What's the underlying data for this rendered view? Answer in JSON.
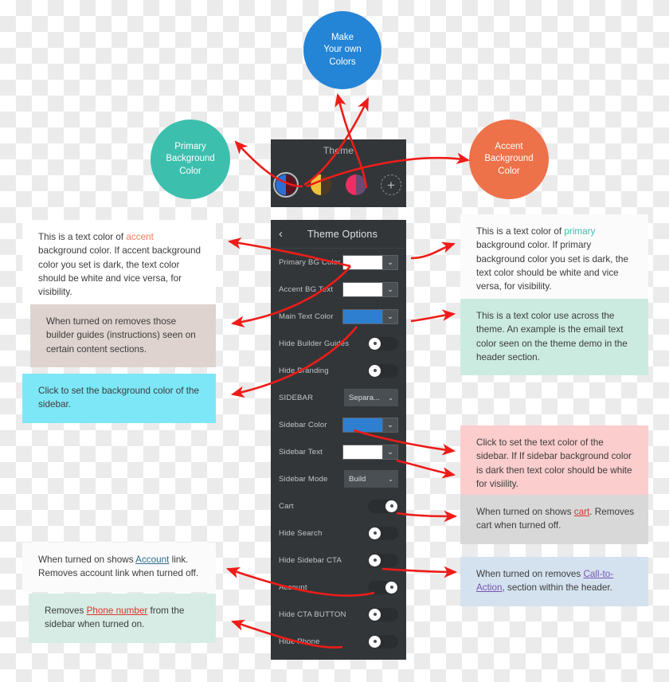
{
  "bubbles": [
    {
      "id": "make-your-own-colors",
      "lines": [
        "Make",
        "Your own",
        "Colors"
      ],
      "color": "#2484d6"
    },
    {
      "id": "primary-background-color",
      "lines": [
        "Primary",
        "Background",
        "Color"
      ],
      "color": "#3dbfae"
    },
    {
      "id": "accent-background-color",
      "lines": [
        "Accent",
        "Background",
        "Color"
      ],
      "color": "#ed7149"
    }
  ],
  "theme_strip": {
    "title": "Theme",
    "swatches": [
      {
        "name": "swatch-blue-maroon",
        "left": "#2a6fd6",
        "right": "#5a1520",
        "selected": true
      },
      {
        "name": "swatch-yellow-brown",
        "left": "#efc03a",
        "right": "#4a3a24",
        "selected": false
      },
      {
        "name": "swatch-pink-purple",
        "left": "#ee2d63",
        "right": "#6b4a73",
        "selected": false
      }
    ],
    "add_label": "+"
  },
  "options_panel": {
    "back_icon": "‹",
    "title": "Theme Options",
    "rows": [
      {
        "name": "primary-bg-color",
        "label": "Primary BG Color",
        "control": "color",
        "value": "#ffffff",
        "chevron": "⌄"
      },
      {
        "name": "accent-bg-text",
        "label": "Accent BG Text",
        "control": "color",
        "value": "#ffffff",
        "chevron": "⌄"
      },
      {
        "name": "main-text-color",
        "label": "Main Text Color",
        "control": "color",
        "value": "#2f7fd1",
        "chevron": "⌄"
      },
      {
        "name": "hide-builder-guides",
        "label": "Hide Builder Guides",
        "control": "toggle",
        "value": "off"
      },
      {
        "name": "hide-branding",
        "label": "Hide Branding",
        "control": "toggle",
        "value": "off"
      },
      {
        "name": "sidebar",
        "label": "SIDEBAR",
        "control": "select",
        "value": "Separa...",
        "chevron": "⌄"
      },
      {
        "name": "sidebar-color",
        "label": "Sidebar Color",
        "control": "color",
        "value": "#2f7fd1",
        "chevron": "⌄"
      },
      {
        "name": "sidebar-text",
        "label": "Sidebar Text",
        "control": "color",
        "value": "#ffffff",
        "chevron": "⌄"
      },
      {
        "name": "sidebar-mode",
        "label": "Sidebar Mode",
        "control": "select",
        "value": "Build",
        "chevron": "⌄"
      },
      {
        "name": "cart",
        "label": "Cart",
        "control": "toggle",
        "value": "on"
      },
      {
        "name": "hide-search",
        "label": "Hide Search",
        "control": "toggle",
        "value": "off"
      },
      {
        "name": "hide-sidebar-cta",
        "label": "Hide Sidebar CTA",
        "control": "toggle",
        "value": "off"
      },
      {
        "name": "account",
        "label": "Account",
        "control": "toggle",
        "value": "on"
      },
      {
        "name": "hide-cta-button",
        "label": "Hide CTA BUTTON",
        "control": "toggle",
        "value": "off"
      },
      {
        "name": "hide-phone",
        "label": "Hide Phone",
        "control": "toggle",
        "value": "off"
      }
    ]
  },
  "callouts": {
    "accent_text": {
      "pre": "This is a text color of ",
      "hl": "accent",
      "post": " background color. If accent background color you set is dark, the text color should be white and vice versa, for visibility."
    },
    "builder_guides": {
      "text": "When turned on removes those builder guides (instructions) seen on certain content sections."
    },
    "sidebar_bg": {
      "text": "Click to set the background color of the sidebar."
    },
    "account": {
      "pre": "When turned on shows ",
      "hl": "Account",
      "post": " link. Removes account link when turned off."
    },
    "phone": {
      "pre": "Removes ",
      "hl": "Phone number",
      "post": " from the sidebar when turned on."
    },
    "primary_text": {
      "pre": "This is a text color of ",
      "hl": "primary",
      "post": " background color. If primary background color you set is dark, the text color should be white and vice versa, for visibility."
    },
    "main_text": {
      "text": "This is a text color use across the theme. An example is the email text color seen on the theme demo in the header section."
    },
    "sidebar_text": {
      "text": "Click to set the text color of the sidebar. If If sidebar background color is dark then text color should be white for visiility."
    },
    "cart": {
      "pre": "When turned on shows ",
      "hl": "cart",
      "post": ". Removes cart when turned off."
    },
    "cta": {
      "pre": "When turned on removes ",
      "hl": "Call-to-Action",
      "post": ", section within the header."
    }
  },
  "arrow_color": "#ee1c18"
}
